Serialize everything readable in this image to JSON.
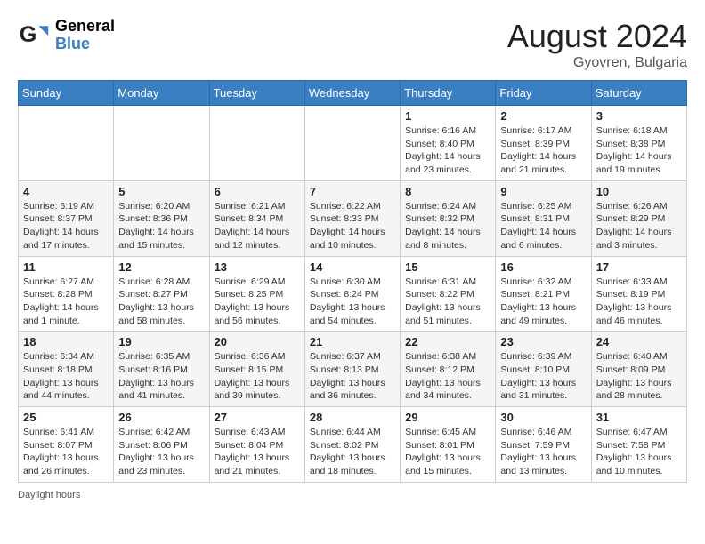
{
  "header": {
    "logo_general": "General",
    "logo_blue": "Blue",
    "month_title": "August 2024",
    "location": "Gyovren, Bulgaria"
  },
  "weekdays": [
    "Sunday",
    "Monday",
    "Tuesday",
    "Wednesday",
    "Thursday",
    "Friday",
    "Saturday"
  ],
  "weeks": [
    [
      {
        "day": "",
        "info": ""
      },
      {
        "day": "",
        "info": ""
      },
      {
        "day": "",
        "info": ""
      },
      {
        "day": "",
        "info": ""
      },
      {
        "day": "1",
        "info": "Sunrise: 6:16 AM\nSunset: 8:40 PM\nDaylight: 14 hours\nand 23 minutes."
      },
      {
        "day": "2",
        "info": "Sunrise: 6:17 AM\nSunset: 8:39 PM\nDaylight: 14 hours\nand 21 minutes."
      },
      {
        "day": "3",
        "info": "Sunrise: 6:18 AM\nSunset: 8:38 PM\nDaylight: 14 hours\nand 19 minutes."
      }
    ],
    [
      {
        "day": "4",
        "info": "Sunrise: 6:19 AM\nSunset: 8:37 PM\nDaylight: 14 hours\nand 17 minutes."
      },
      {
        "day": "5",
        "info": "Sunrise: 6:20 AM\nSunset: 8:36 PM\nDaylight: 14 hours\nand 15 minutes."
      },
      {
        "day": "6",
        "info": "Sunrise: 6:21 AM\nSunset: 8:34 PM\nDaylight: 14 hours\nand 12 minutes."
      },
      {
        "day": "7",
        "info": "Sunrise: 6:22 AM\nSunset: 8:33 PM\nDaylight: 14 hours\nand 10 minutes."
      },
      {
        "day": "8",
        "info": "Sunrise: 6:24 AM\nSunset: 8:32 PM\nDaylight: 14 hours\nand 8 minutes."
      },
      {
        "day": "9",
        "info": "Sunrise: 6:25 AM\nSunset: 8:31 PM\nDaylight: 14 hours\nand 6 minutes."
      },
      {
        "day": "10",
        "info": "Sunrise: 6:26 AM\nSunset: 8:29 PM\nDaylight: 14 hours\nand 3 minutes."
      }
    ],
    [
      {
        "day": "11",
        "info": "Sunrise: 6:27 AM\nSunset: 8:28 PM\nDaylight: 14 hours\nand 1 minute."
      },
      {
        "day": "12",
        "info": "Sunrise: 6:28 AM\nSunset: 8:27 PM\nDaylight: 13 hours\nand 58 minutes."
      },
      {
        "day": "13",
        "info": "Sunrise: 6:29 AM\nSunset: 8:25 PM\nDaylight: 13 hours\nand 56 minutes."
      },
      {
        "day": "14",
        "info": "Sunrise: 6:30 AM\nSunset: 8:24 PM\nDaylight: 13 hours\nand 54 minutes."
      },
      {
        "day": "15",
        "info": "Sunrise: 6:31 AM\nSunset: 8:22 PM\nDaylight: 13 hours\nand 51 minutes."
      },
      {
        "day": "16",
        "info": "Sunrise: 6:32 AM\nSunset: 8:21 PM\nDaylight: 13 hours\nand 49 minutes."
      },
      {
        "day": "17",
        "info": "Sunrise: 6:33 AM\nSunset: 8:19 PM\nDaylight: 13 hours\nand 46 minutes."
      }
    ],
    [
      {
        "day": "18",
        "info": "Sunrise: 6:34 AM\nSunset: 8:18 PM\nDaylight: 13 hours\nand 44 minutes."
      },
      {
        "day": "19",
        "info": "Sunrise: 6:35 AM\nSunset: 8:16 PM\nDaylight: 13 hours\nand 41 minutes."
      },
      {
        "day": "20",
        "info": "Sunrise: 6:36 AM\nSunset: 8:15 PM\nDaylight: 13 hours\nand 39 minutes."
      },
      {
        "day": "21",
        "info": "Sunrise: 6:37 AM\nSunset: 8:13 PM\nDaylight: 13 hours\nand 36 minutes."
      },
      {
        "day": "22",
        "info": "Sunrise: 6:38 AM\nSunset: 8:12 PM\nDaylight: 13 hours\nand 34 minutes."
      },
      {
        "day": "23",
        "info": "Sunrise: 6:39 AM\nSunset: 8:10 PM\nDaylight: 13 hours\nand 31 minutes."
      },
      {
        "day": "24",
        "info": "Sunrise: 6:40 AM\nSunset: 8:09 PM\nDaylight: 13 hours\nand 28 minutes."
      }
    ],
    [
      {
        "day": "25",
        "info": "Sunrise: 6:41 AM\nSunset: 8:07 PM\nDaylight: 13 hours\nand 26 minutes."
      },
      {
        "day": "26",
        "info": "Sunrise: 6:42 AM\nSunset: 8:06 PM\nDaylight: 13 hours\nand 23 minutes."
      },
      {
        "day": "27",
        "info": "Sunrise: 6:43 AM\nSunset: 8:04 PM\nDaylight: 13 hours\nand 21 minutes."
      },
      {
        "day": "28",
        "info": "Sunrise: 6:44 AM\nSunset: 8:02 PM\nDaylight: 13 hours\nand 18 minutes."
      },
      {
        "day": "29",
        "info": "Sunrise: 6:45 AM\nSunset: 8:01 PM\nDaylight: 13 hours\nand 15 minutes."
      },
      {
        "day": "30",
        "info": "Sunrise: 6:46 AM\nSunset: 7:59 PM\nDaylight: 13 hours\nand 13 minutes."
      },
      {
        "day": "31",
        "info": "Sunrise: 6:47 AM\nSunset: 7:58 PM\nDaylight: 13 hours\nand 10 minutes."
      }
    ]
  ],
  "footer": {
    "daylight_hours_label": "Daylight hours"
  }
}
